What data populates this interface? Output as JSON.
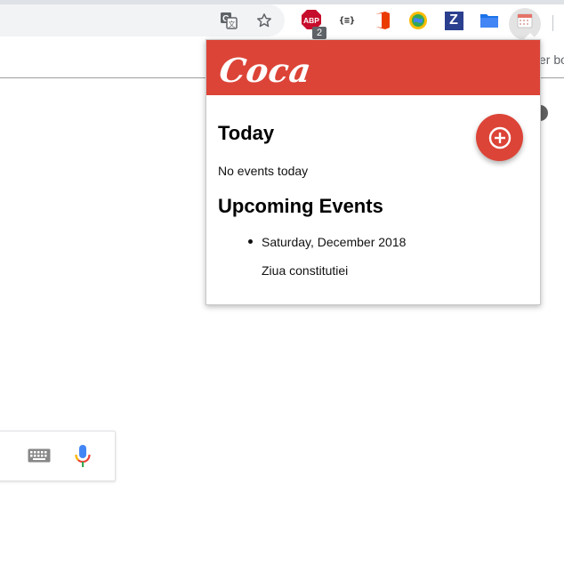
{
  "browser": {
    "bookmarks_bar_fragment": "er bo",
    "omnibox_icons": [
      "translate-icon",
      "bookmark-star-icon"
    ],
    "extensions": [
      {
        "name": "adblock-plus-icon",
        "label": "ABP",
        "badge": "2"
      },
      {
        "name": "json-viewer-icon",
        "label": "{≡}"
      },
      {
        "name": "office-icon"
      },
      {
        "name": "globe-extension-icon"
      },
      {
        "name": "z-extension-icon",
        "label": "Z"
      },
      {
        "name": "folder-extension-icon"
      },
      {
        "name": "calendar-extension-icon",
        "active": true
      }
    ]
  },
  "popup": {
    "logo": "Coca",
    "header_color": "#dc4437",
    "today_heading": "Today",
    "no_events_text": "No events today",
    "upcoming_heading": "Upcoming Events",
    "events": [
      {
        "date": "Saturday, December 2018",
        "name": "Ziua constitutiei"
      }
    ],
    "add_button_icon": "add-circle-icon"
  },
  "page": {
    "search_icons": [
      "keyboard-icon",
      "microphone-icon"
    ]
  }
}
